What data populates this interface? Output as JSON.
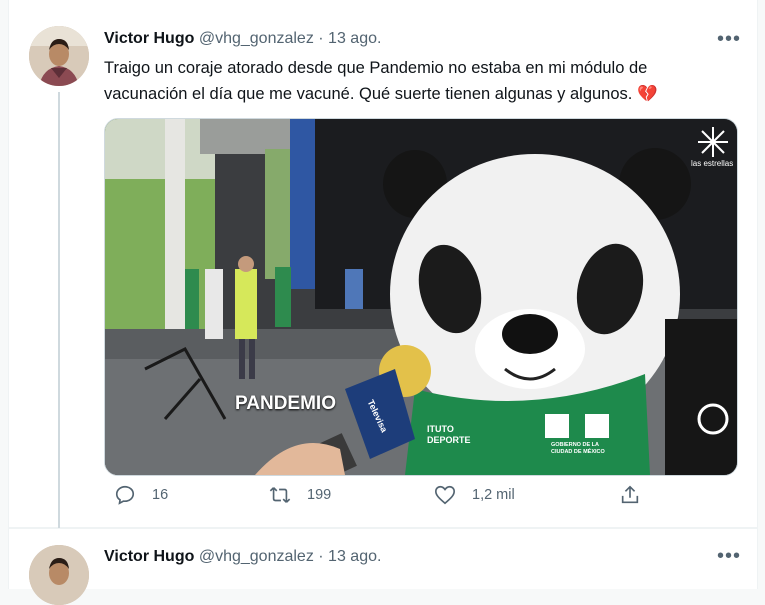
{
  "tweet": {
    "name": "Victor Hugo",
    "handle": "@vhg_gonzalez",
    "separator": "·",
    "date": "13 ago.",
    "text": "Traigo un coraje atorado desde que Pandemio no estaba en mi módulo de vacunación el día que me vacuné. Qué suerte tienen algunas y algunos.",
    "emoji": "💔",
    "media": {
      "caption": "PANDEMIO",
      "channel_label": "las estrellas",
      "mic_label": "Televisa",
      "vest_label_1": "ITUTO",
      "vest_label_2": "DEPORTE",
      "vest_label_3": "GOBIERNO DE LA",
      "vest_label_4": "CIUDAD DE MÉXICO"
    },
    "actions": {
      "replies": "16",
      "retweets": "199",
      "likes": "1,2 mil"
    }
  },
  "next_tweet": {
    "name": "Victor Hugo",
    "handle": "@vhg_gonzalez",
    "separator": "·",
    "date": "13 ago."
  },
  "more_label": "•••",
  "colors": {
    "text": "#0f1419",
    "secondary": "#536471",
    "border": "#cfd9de",
    "heart": "#c3243b",
    "vest": "#1e8a4c"
  },
  "icons": [
    "reply-icon",
    "retweet-icon",
    "like-icon",
    "share-icon",
    "more-icon"
  ]
}
